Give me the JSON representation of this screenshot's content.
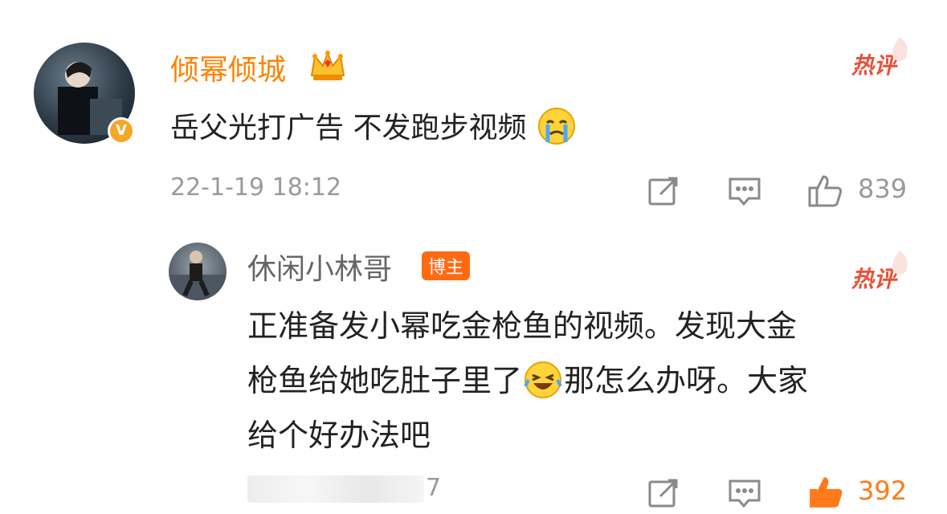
{
  "comment": {
    "username": "倾幂倾城",
    "hot_tag": "热评",
    "text": "岳父光打广告 不发跑步视频",
    "timestamp": "22-1-19 18:12",
    "likes": "839",
    "verified_badge": "V"
  },
  "reply": {
    "username": "休闲小林哥",
    "role_badge": "博主",
    "hot_tag": "热评",
    "lines": [
      "正准备发小幂吃金枪鱼的视频。发现大金",
      "枪鱼给她吃肚子里了",
      "那怎么办呀。大家",
      "给个好办法吧"
    ],
    "timestamp_tail": "7",
    "likes": "392"
  },
  "colors": {
    "username_orange": "#ff8200",
    "hot_red": "#e8503a",
    "badge_orange": "#ff6a13",
    "like_active": "#ff7a1a",
    "meta_gray": "#9a9a9a"
  },
  "icons": [
    "crown-icon",
    "crying-emoji-icon",
    "laughing-emoji-icon",
    "repost-icon",
    "comment-icon",
    "thumbs-up-icon",
    "hot-flame-icon"
  ]
}
